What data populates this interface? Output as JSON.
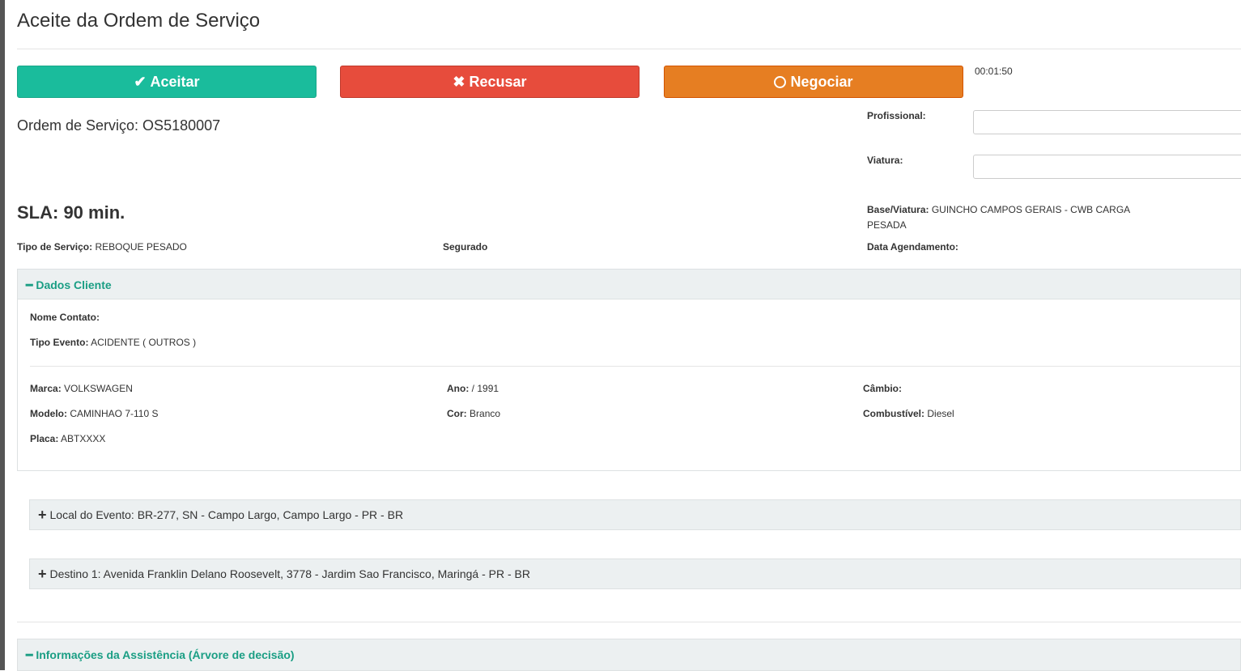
{
  "title": "Aceite da Ordem de Serviço",
  "buttons": {
    "accept": "Aceitar",
    "refuse": "Recusar",
    "negotiate": "Negociar"
  },
  "timer": "00:01:50",
  "order": "Ordem de Serviço: OS5180007",
  "sla": "SLA: 90 min.",
  "fields": {
    "profissional_label": "Profissional:",
    "profissional_value": "",
    "viatura_label": "Viatura:",
    "viatura_value": "",
    "base_label": "Base/Viatura:",
    "base_value": "GUINCHO CAMPOS GERAIS - CWB CARGA PESADA",
    "tipo_servico_label": "Tipo de Serviço:",
    "tipo_servico_value": "REBOQUE PESADO",
    "segurado_label": "Segurado",
    "data_agendamento_label": "Data Agendamento:"
  },
  "dados_cliente": {
    "title": "Dados Cliente",
    "nome_contato_label": "Nome Contato:",
    "tipo_evento_label": "Tipo Evento:",
    "tipo_evento_value": "ACIDENTE ( OUTROS )",
    "marca_label": "Marca:",
    "marca_value": "VOLKSWAGEN",
    "modelo_label": "Modelo:",
    "modelo_value": "CAMINHAO 7-110 S",
    "placa_label": "Placa:",
    "placa_value": "ABTXXXX",
    "ano_label": "Ano:",
    "ano_value": "/ 1991",
    "cor_label": "Cor:",
    "cor_value": "Branco",
    "cambio_label": "Câmbio:",
    "combustivel_label": "Combustível:",
    "combustivel_value": "Diesel"
  },
  "local_evento": "Local do Evento: BR-277, SN - Campo Largo, Campo Largo - PR - BR",
  "destino": "Destino 1: Avenida Franklin Delano Roosevelt, 3778 - Jardim Sao Francisco, Maringá - PR - BR",
  "informacoes": "Informações da Assistência (Árvore de decisão)"
}
